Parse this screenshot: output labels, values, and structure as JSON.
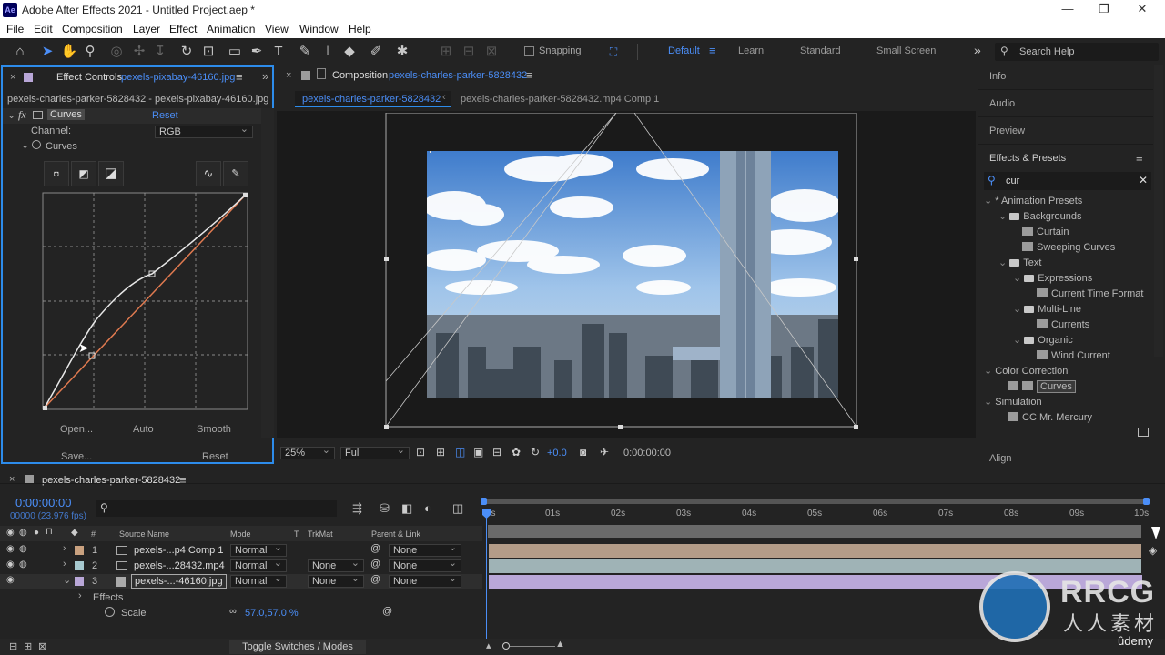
{
  "window": {
    "title": "Adobe After Effects 2021 - Untitled Project.aep *",
    "logo": "Ae",
    "controls": [
      "—",
      "❐",
      "✕"
    ]
  },
  "menu": [
    "File",
    "Edit",
    "Composition",
    "Layer",
    "Effect",
    "Animation",
    "View",
    "Window",
    "Help"
  ],
  "toolbar": {
    "snapping_label": "Snapping",
    "workspaces": [
      "Default",
      "Learn",
      "Standard",
      "Small Screen"
    ],
    "active_workspace": "Default",
    "search_help": "Search Help",
    "expand": "»"
  },
  "effect_controls": {
    "tab_label": "Effect Controls",
    "tab_file": "pexels-pixabay-46160.jpg",
    "breadcrumb": "pexels-charles-parker-5828432 - pexels-pixabay-46160.jpg",
    "fx_label": "fx",
    "effect_name": "Curves",
    "reset": "Reset",
    "channel_label": "Channel:",
    "channel_value": "RGB",
    "curves_label": "Curves",
    "buttons": [
      "Open...",
      "Auto",
      "Smooth",
      "Save...",
      "Reset"
    ]
  },
  "composition": {
    "tab_label": "Composition",
    "tab_name": "pexels-charles-parker-5828432",
    "subtabs": [
      "pexels-charles-parker-5828432",
      "pexels-charles-parker-5828432.mp4 Comp 1"
    ],
    "zoom": "25%",
    "resolution": "Full",
    "exposure": "+0.0",
    "timecode": "0:00:00:00"
  },
  "right_panels": {
    "info": "Info",
    "audio": "Audio",
    "preview": "Preview",
    "effects_presets": "Effects & Presets",
    "search_value": "cur",
    "align": "Align",
    "tree": [
      {
        "label": "* Animation Presets",
        "type": "root"
      },
      {
        "label": "Backgrounds",
        "type": "folder"
      },
      {
        "label": "Curtain",
        "type": "preset"
      },
      {
        "label": "Sweeping Curves",
        "type": "preset"
      },
      {
        "label": "Text",
        "type": "folder"
      },
      {
        "label": "Expressions",
        "type": "folder"
      },
      {
        "label": "Current Time Format",
        "type": "preset"
      },
      {
        "label": "Multi-Line",
        "type": "folder"
      },
      {
        "label": "Currents",
        "type": "preset"
      },
      {
        "label": "Organic",
        "type": "folder"
      },
      {
        "label": "Wind Current",
        "type": "preset"
      },
      {
        "label": "Color Correction",
        "type": "root"
      },
      {
        "label": "Curves",
        "type": "effect"
      },
      {
        "label": "Simulation",
        "type": "root"
      },
      {
        "label": "CC Mr. Mercury",
        "type": "effect"
      }
    ]
  },
  "timeline": {
    "comp_name": "pexels-charles-parker-5828432",
    "timecode": "0:00:00:00",
    "frames": "00000 (23.976 fps)",
    "columns": [
      "#",
      "Source Name",
      "Mode",
      "T",
      "TrkMat",
      "Parent & Link"
    ],
    "layers": [
      {
        "num": "1",
        "name": "pexels-...p4 Comp 1",
        "mode": "Normal",
        "trkmat": "",
        "parent": "None",
        "color": "#c9a17f"
      },
      {
        "num": "2",
        "name": "pexels-...28432.mp4",
        "mode": "Normal",
        "trkmat": "None",
        "parent": "None",
        "color": "#a7c9cf"
      },
      {
        "num": "3",
        "name": "pexels-...-46160.jpg",
        "mode": "Normal",
        "trkmat": "None",
        "parent": "None",
        "color": "#b9a7d8"
      }
    ],
    "effects_label": "Effects",
    "scale_label": "Scale",
    "scale_value": "57.0,57.0 %",
    "ruler": [
      "0s",
      "01s",
      "02s",
      "03s",
      "04s",
      "05s",
      "06s",
      "07s",
      "08s",
      "09s",
      "10s"
    ],
    "toggle_label": "Toggle Switches / Modes"
  },
  "watermark": {
    "brand": "RRCG",
    "sub": "人人素材",
    "udemy": "ûdemy"
  },
  "colors": {
    "accent": "#4b8ef7",
    "panel": "#232323",
    "bar1": "#b49c88",
    "bar2": "#9fb3b6",
    "bar3": "#b9a7d8"
  }
}
